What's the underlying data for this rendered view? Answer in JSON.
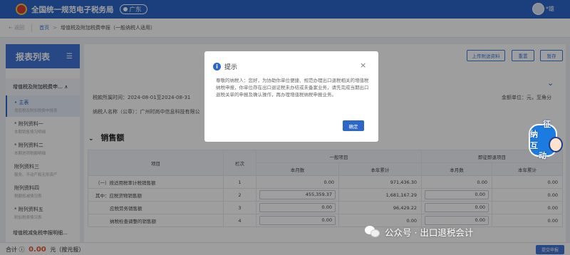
{
  "header": {
    "title": "全国统一规范电子税务局",
    "region": "广东",
    "user": "*雄"
  },
  "breadcrumb": {
    "back": "← 返回",
    "home": "首页",
    "arrow": ">",
    "current": "增值税及附加税费申报（一般纳税人适用）"
  },
  "sidebar": {
    "title": "报表列表",
    "menu_icon": "☰",
    "group": "增值税及附加税费申… ∧",
    "items": [
      {
        "title": "• 主表",
        "subtitle": "增值税及附加税费申报表",
        "active": true
      },
      {
        "title": "* 附列资料一",
        "subtitle": "本期销售情况明细"
      },
      {
        "title": "* 附列资料二",
        "subtitle": "本期进项税额明细"
      },
      {
        "title": "附列资料三",
        "subtitle": "服务、不动产和无形资产"
      },
      {
        "title": "附列资料四",
        "subtitle": "税额抵减情况表"
      },
      {
        "title": "* 附列资料五",
        "subtitle": "附加税费情况表"
      }
    ],
    "last": "增值税减免税申报明细…"
  },
  "toolbar": {
    "upload_label": "上传附送资料",
    "reset_label": "重置",
    "save_label": "暂存"
  },
  "info": {
    "period": "税款所属时间：2024-08-01至2024-08-31",
    "taxpayer": "纳税人名称（公章）：广州时尚中信息科技有限公",
    "unit": "金额单位：元，至角分"
  },
  "section": {
    "caret": "⌄",
    "title": "销售额"
  },
  "table": {
    "header_item": "项目",
    "header_row": "栏次",
    "header_general": "一般项目",
    "header_refund": "即征即退项目",
    "sub_month": "本月数",
    "sub_ytd": "本年累计",
    "rows": [
      {
        "item": "（一）按适用税率计税销售额",
        "no": "1",
        "g_month": "0.00",
        "g_ytd": "971,436.30",
        "r_month": "0.00",
        "r_ytd": "0.00",
        "inputs": false
      },
      {
        "item": "其中：应税货物销售额",
        "no": "2",
        "g_month": "455,359.37",
        "g_ytd": "1,681,167.29",
        "r_month": "0.00",
        "r_ytd": "0.00",
        "inputs": true
      },
      {
        "item": "应税劳务销售额",
        "no": "3",
        "g_month": "0.00",
        "g_ytd": "96,429.22",
        "r_month": "0.00",
        "r_ytd": "0.00",
        "inputs": true
      },
      {
        "item": "纳税检查调整的销售额",
        "no": "4",
        "g_month": "0.00",
        "g_ytd": "0.00",
        "r_month": "0.00",
        "r_ytd": "0.00",
        "inputs": true
      }
    ]
  },
  "footer": {
    "label": "合计",
    "icon": "ⓘ",
    "amount": "0.00",
    "suffix": "元（按元报）",
    "submit": "提交申报"
  },
  "modal": {
    "info_icon": "i",
    "title": "提示",
    "close": "×",
    "body": "尊敬的纳税人：您好，为协助你单位便捷、规范办理出口退税相关的增值税纳税申报，你单位存在出口退证税未办结或未备案业务，请先完成当期出口退税关单的申报及确认操作，再办理增值税纳税申报业务。",
    "ok_label": "确定"
  },
  "mascot": {
    "c1": "征",
    "c2": "纳",
    "c3": "互",
    "c4": "动"
  },
  "watermark": {
    "text": "公众号 · 出口退税会计"
  }
}
